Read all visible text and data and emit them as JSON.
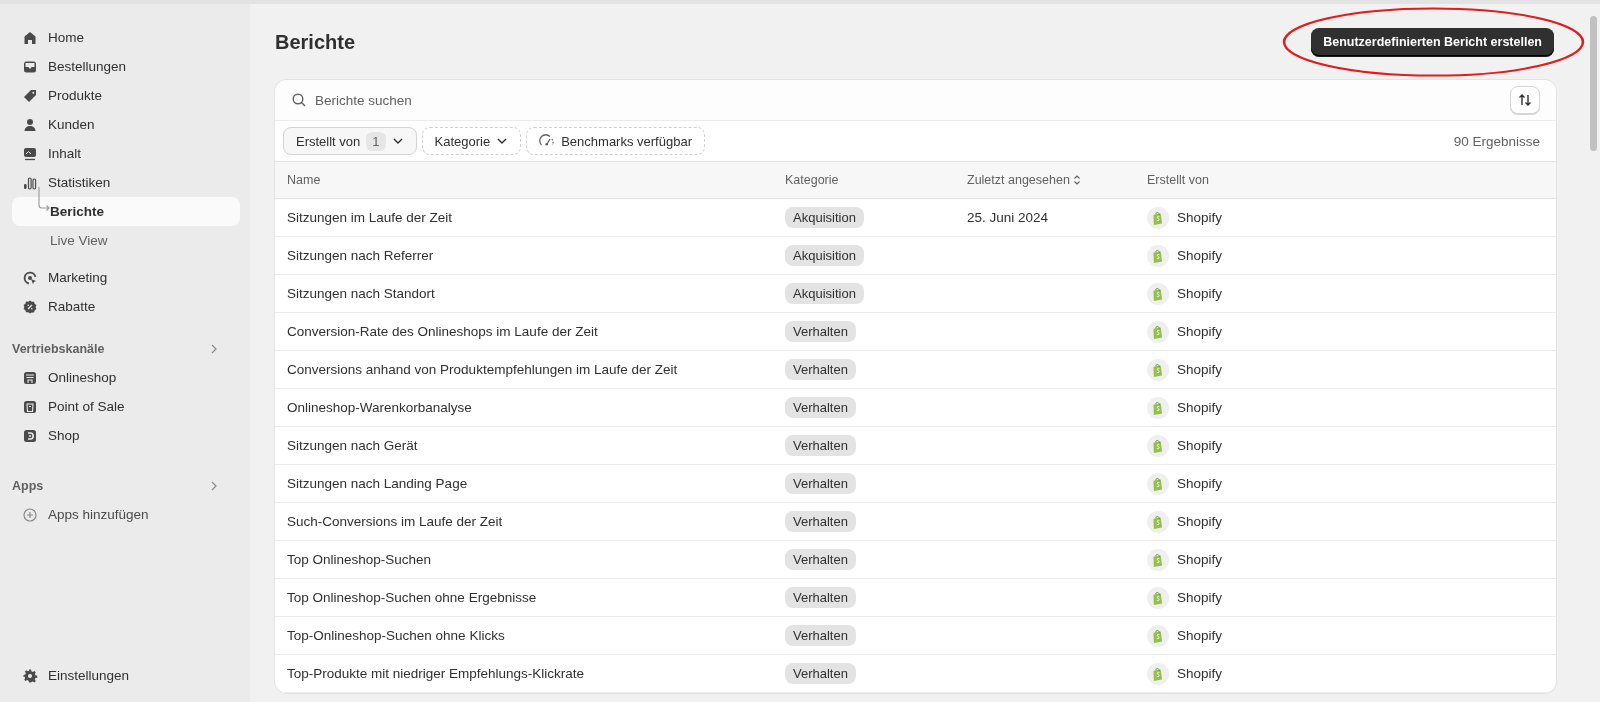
{
  "sidebar": {
    "items": [
      {
        "label": "Home",
        "selected": false
      },
      {
        "label": "Bestellungen",
        "selected": false
      },
      {
        "label": "Produkte",
        "selected": false
      },
      {
        "label": "Kunden",
        "selected": false
      },
      {
        "label": "Inhalt",
        "selected": false
      },
      {
        "label": "Statistiken",
        "selected": false,
        "children": [
          {
            "label": "Berichte",
            "selected": true
          },
          {
            "label": "Live View",
            "selected": false
          }
        ]
      },
      {
        "label": "Marketing",
        "selected": false
      },
      {
        "label": "Rabatte",
        "selected": false
      }
    ],
    "sections": [
      {
        "title": "Vertriebskanäle",
        "items": [
          {
            "label": "Onlineshop",
            "selected": false
          },
          {
            "label": "Point of Sale",
            "selected": false
          },
          {
            "label": "Shop",
            "selected": false
          }
        ]
      },
      {
        "title": "Apps",
        "items": [
          {
            "label": "Apps hinzufügen",
            "selected": false
          }
        ]
      }
    ],
    "footer": {
      "label": "Einstellungen"
    }
  },
  "page": {
    "title": "Berichte",
    "primary_button": "Benutzerdefinierten Bericht erstellen"
  },
  "search": {
    "placeholder": "Berichte suchen"
  },
  "filters": [
    {
      "label": "Erstellt von",
      "count": "1",
      "kind": "dropdown",
      "applied": true
    },
    {
      "label": "Kategorie",
      "kind": "dropdown",
      "applied": false
    },
    {
      "label": "Benchmarks verfügbar",
      "kind": "toggle",
      "applied": false
    }
  ],
  "results": "90 Ergebnisse",
  "table": {
    "columns": [
      {
        "label": "Name",
        "sort_icon": false
      },
      {
        "label": "Kategorie",
        "sort_icon": false
      },
      {
        "label": "Zuletzt angesehen",
        "sort_icon": true
      },
      {
        "label": "Erstellt von",
        "sort_icon": false
      }
    ],
    "rows": [
      {
        "name": "Sitzungen im Laufe der Zeit",
        "category": "Akquisition",
        "last_viewed": "25. Juni 2024",
        "created_by": "Shopify"
      },
      {
        "name": "Sitzungen nach Referrer",
        "category": "Akquisition",
        "created_by": "Shopify"
      },
      {
        "name": "Sitzungen nach Standort",
        "category": "Akquisition",
        "created_by": "Shopify"
      },
      {
        "name": "Conversion-Rate des Onlineshops im Laufe der Zeit",
        "category": "Verhalten",
        "created_by": "Shopify"
      },
      {
        "name": "Conversions anhand von Produktempfehlungen im Laufe der Zeit",
        "category": "Verhalten",
        "created_by": "Shopify"
      },
      {
        "name": "Onlineshop-Warenkorbanalyse",
        "category": "Verhalten",
        "created_by": "Shopify"
      },
      {
        "name": "Sitzungen nach Gerät",
        "category": "Verhalten",
        "created_by": "Shopify"
      },
      {
        "name": "Sitzungen nach Landing Page",
        "category": "Verhalten",
        "created_by": "Shopify"
      },
      {
        "name": "Such-Conversions im Laufe der Zeit",
        "category": "Verhalten",
        "created_by": "Shopify"
      },
      {
        "name": "Top Onlineshop-Suchen",
        "category": "Verhalten",
        "created_by": "Shopify"
      },
      {
        "name": "Top Onlineshop-Suchen ohne Ergebnisse",
        "category": "Verhalten",
        "created_by": "Shopify"
      },
      {
        "name": "Top-Onlineshop-Suchen ohne Klicks",
        "category": "Verhalten",
        "created_by": "Shopify"
      },
      {
        "name": "Top-Produkte mit niedriger Empfehlungs-Klickrate",
        "category": "Verhalten",
        "created_by": "Shopify"
      }
    ]
  }
}
